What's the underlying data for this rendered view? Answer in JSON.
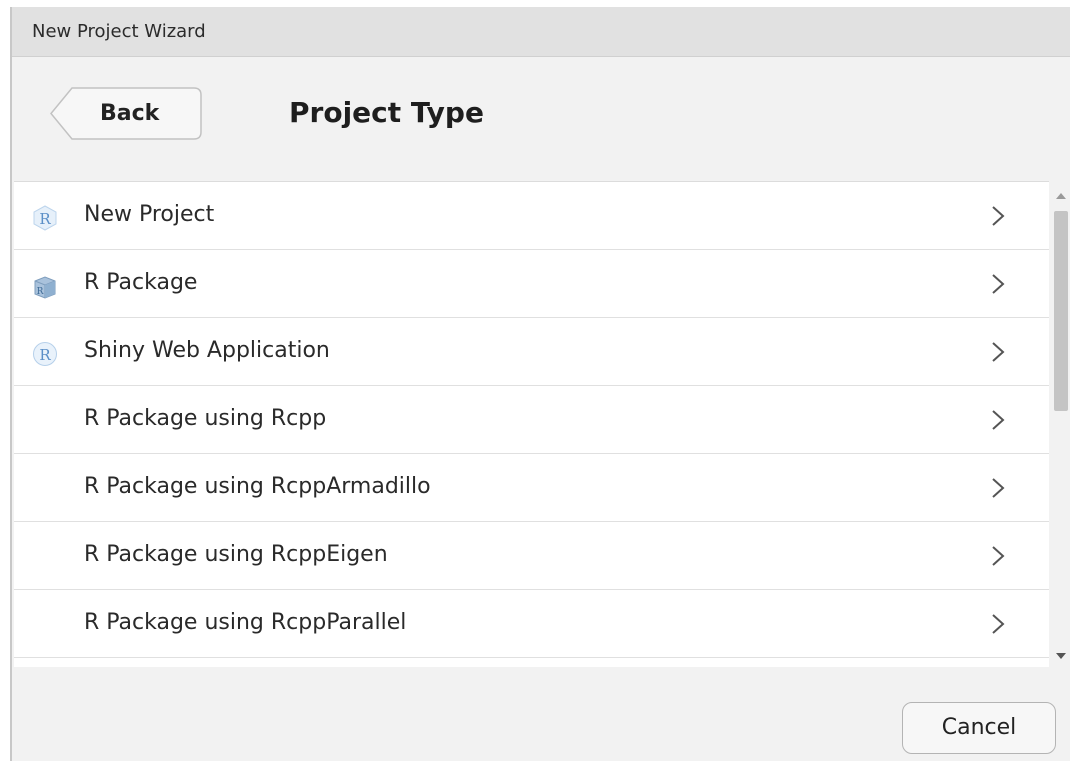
{
  "window": {
    "title": "New Project Wizard"
  },
  "header": {
    "back_label": "Back",
    "title": "Project Type"
  },
  "project_types": [
    {
      "label": "New Project",
      "icon": "r-project-icon"
    },
    {
      "label": "R Package",
      "icon": "r-package-icon"
    },
    {
      "label": "Shiny Web Application",
      "icon": "shiny-app-icon"
    },
    {
      "label": "R Package using Rcpp",
      "icon": ""
    },
    {
      "label": "R Package using RcppArmadillo",
      "icon": ""
    },
    {
      "label": "R Package using RcppEigen",
      "icon": ""
    },
    {
      "label": "R Package using RcppParallel",
      "icon": ""
    }
  ],
  "footer": {
    "cancel_label": "Cancel"
  },
  "colors": {
    "icon_blue": "#5b8fc7",
    "chevron": "#555555"
  }
}
